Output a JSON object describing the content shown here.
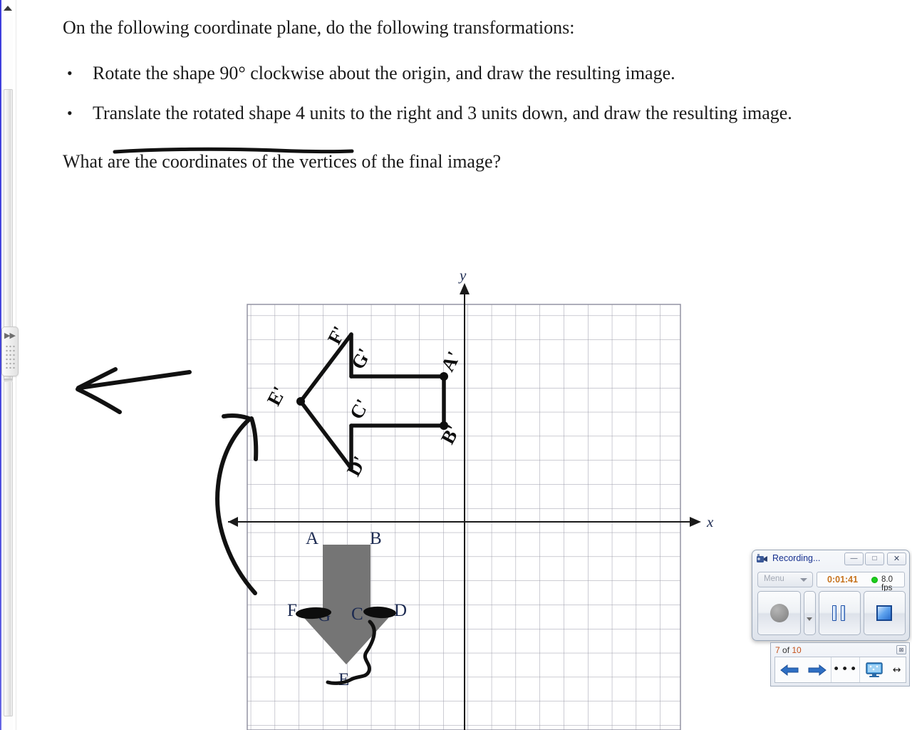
{
  "document": {
    "lead": "On the following coordinate plane, do the following transformations:",
    "bullet_marker": "•",
    "bullets": [
      "Rotate the shape 90° clockwise about the origin, and draw the resulting image.",
      "Translate the rotated shape 4 units to the right and 3 units down, and draw the resulting image."
    ],
    "question": "What are the coordinates of the vertices of the final image?"
  },
  "plane": {
    "x_axis_label": "x",
    "y_axis_label": "y",
    "original_vertex_labels": [
      "A",
      "B",
      "C",
      "D",
      "E",
      "F",
      "G"
    ],
    "image_vertex_labels": [
      "A'",
      "B'",
      "C'",
      "D'",
      "E'",
      "F'",
      "G'"
    ],
    "shape_fill": "#757575",
    "ink_color": "#111111",
    "label_color": "#1d2b52",
    "grid_line_color": "#9a9aa8",
    "grid_cols": 18,
    "grid_rows": 17
  },
  "recorder": {
    "title": "Recording...",
    "icon": "camcorder-icon",
    "minimize_label": "—",
    "maximize_label": "□",
    "close_label": "✕",
    "menu_label": "Menu",
    "timer": "0:01:41",
    "fps": "8.0 fps",
    "status_color": "#1ecf1e",
    "timer_color": "#c7731d",
    "record_label": "record",
    "pause_label": "pause",
    "stop_label": "stop"
  },
  "slide_nav": {
    "current": "7",
    "separator": " of ",
    "total": "10",
    "close_label": "⊠",
    "prev_label": "⬅",
    "next_label": "➡",
    "more_label": "•••",
    "screen_label": "monitor-icon",
    "resize_label": "↔"
  },
  "left_rail": {
    "scroll_up_label": "scroll-up",
    "handle_label": "▶▶"
  }
}
